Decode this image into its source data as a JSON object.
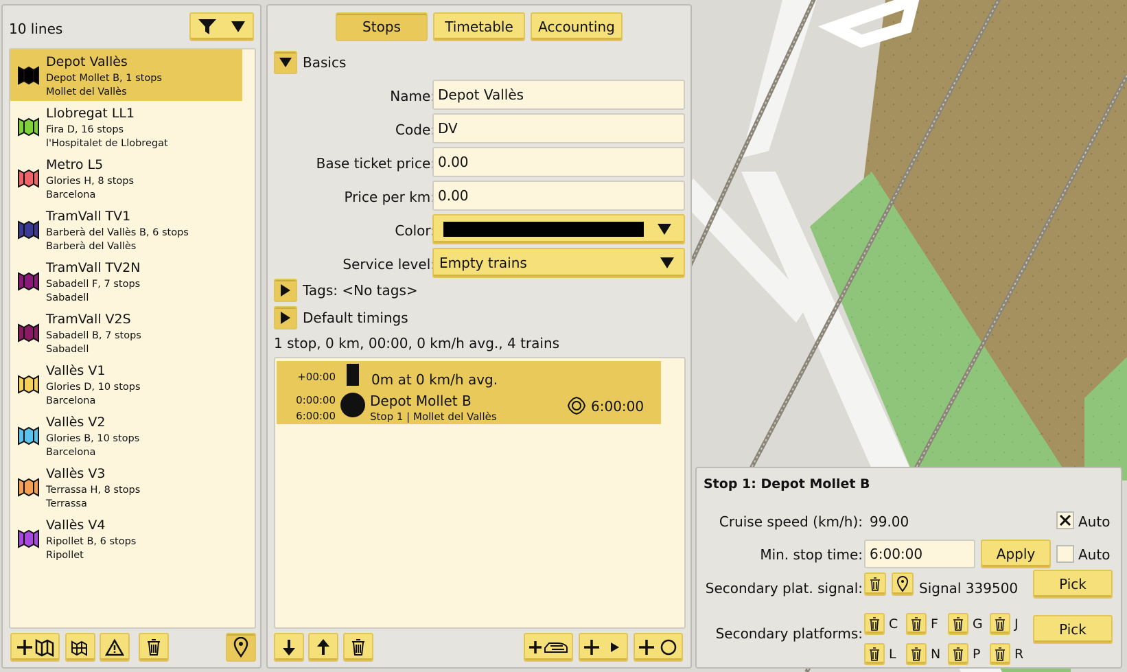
{
  "left": {
    "lines_count": "10 lines",
    "lines": [
      {
        "name": "Depot Vallès",
        "sub": "Depot Mollet B, 1 stops",
        "city": "Mollet del Vallès",
        "color": "#000000",
        "selected": true
      },
      {
        "name": "Llobregat LL1",
        "sub": "Fira D, 16 stops",
        "city": "l'Hospitalet de Llobregat",
        "color": "#7fd23a"
      },
      {
        "name": "Metro L5",
        "sub": "Glories H, 8 stops",
        "city": "Barcelona",
        "color": "#f0656a"
      },
      {
        "name": "TramVall TV1",
        "sub": "Barberà del Vallès B, 6 stops",
        "city": "Barberà del Vallès",
        "color": "#3b3a95"
      },
      {
        "name": "TramVall TV2N",
        "sub": "Sabadell F, 7 stops",
        "city": "Sabadell",
        "color": "#8a1a78"
      },
      {
        "name": "TramVall V2S",
        "sub": "Sabadell B, 7 stops",
        "city": "Sabadell",
        "color": "#8a1a62"
      },
      {
        "name": "Vallès V1",
        "sub": "Glories D, 10 stops",
        "city": "Barcelona",
        "color": "#f6d25a"
      },
      {
        "name": "Vallès V2",
        "sub": "Glories B, 10 stops",
        "city": "Barcelona",
        "color": "#5cc3ec"
      },
      {
        "name": "Vallès V3",
        "sub": "Terrassa H, 8 stops",
        "city": "Terrassa",
        "color": "#f6a055"
      },
      {
        "name": "Vallès V4",
        "sub": "Ripollet B, 6 stops",
        "city": "Ripollet",
        "color": "#a84ae0"
      }
    ],
    "icons": [
      "filter-icon",
      "dropdown-arrow-icon",
      "add-line-icon",
      "map-lines-icon",
      "warning-icon",
      "trash-icon",
      "locate-pin-icon"
    ]
  },
  "center": {
    "tabs": [
      {
        "label": "Stops"
      },
      {
        "label": "Timetable"
      },
      {
        "label": "Accounting"
      }
    ],
    "active_tab": "Stops",
    "basics_label": "Basics",
    "fields": {
      "name_label": "Name:",
      "name_value": "Depot Vallès",
      "code_label": "Code:",
      "code_value": "DV",
      "price_label": "Base ticket price:",
      "price_value": "0.00",
      "perkm_label": "Price per km:",
      "perkm_value": "0.00",
      "color_label": "Color:",
      "color_value": "#000000",
      "service_label": "Service level:",
      "service_value": "Empty trains"
    },
    "tags_label": "Tags: <No tags>",
    "timings_label": "Default timings",
    "summary": "1 stop, 0 km, 00:00, 0 km/h avg., 4 trains",
    "stop_row": {
      "offset": "+00:00",
      "segment_text": "0m at 0 km/h avg.",
      "arrive": "0:00:00",
      "depart": "6:00:00",
      "name": "Depot Mollet B",
      "sub": "Stop 1 | Mollet del Vallès",
      "wait": "6:00:00"
    }
  },
  "stop_panel": {
    "title": "Stop 1: Depot Mollet B",
    "cruise_label": "Cruise speed (km/h):",
    "cruise_value": "99.00",
    "auto_label": "Auto",
    "auto1_checked": true,
    "minstop_label": "Min. stop time:",
    "minstop_value": "6:00:00",
    "apply_label": "Apply",
    "auto2_checked": false,
    "secsignal_label": "Secondary plat. signal:",
    "signal_text": "Signal 339500",
    "pick_label": "Pick",
    "secplat_label": "Secondary platforms:",
    "platforms_row1": [
      "C",
      "F",
      "G",
      "J"
    ],
    "platforms_row2": [
      "L",
      "N",
      "P",
      "R"
    ]
  }
}
